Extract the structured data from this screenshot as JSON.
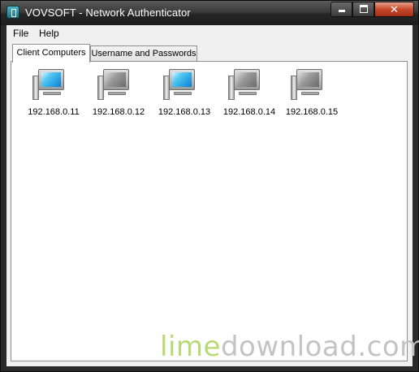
{
  "window": {
    "title": "VOVSOFT - Network Authenticator",
    "close_glyph": "✕"
  },
  "menu": {
    "items": [
      {
        "label": "File"
      },
      {
        "label": "Help"
      }
    ]
  },
  "tabs": [
    {
      "label": "Client Computers",
      "active": true
    },
    {
      "label": "Username and Passwords",
      "active": false
    }
  ],
  "computers": [
    {
      "ip": "192.168.0.11",
      "state": "online",
      "icon": "computer-online-icon"
    },
    {
      "ip": "192.168.0.12",
      "state": "offline",
      "icon": "computer-offline-icon"
    },
    {
      "ip": "192.168.0.13",
      "state": "online",
      "icon": "computer-online-icon"
    },
    {
      "ip": "192.168.0.14",
      "state": "offline",
      "icon": "computer-offline-icon"
    },
    {
      "ip": "192.168.0.15",
      "state": "offline",
      "icon": "computer-offline-icon"
    }
  ],
  "watermark": {
    "part1": "lime",
    "part2": "download.com"
  },
  "colors": {
    "online_screen": "#0a7fd0",
    "offline_screen": "#8a8a8a",
    "close_button": "#c8482b"
  }
}
